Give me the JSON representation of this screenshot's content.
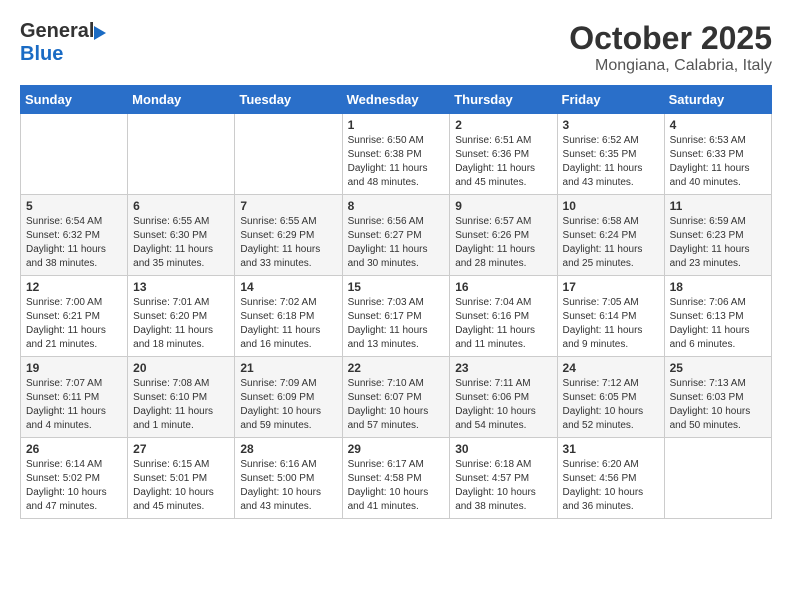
{
  "header": {
    "title": "October 2025",
    "subtitle": "Mongiana, Calabria, Italy",
    "logo_general": "General",
    "logo_blue": "Blue"
  },
  "days_of_week": [
    "Sunday",
    "Monday",
    "Tuesday",
    "Wednesday",
    "Thursday",
    "Friday",
    "Saturday"
  ],
  "weeks": [
    [
      {
        "day": "",
        "info": ""
      },
      {
        "day": "",
        "info": ""
      },
      {
        "day": "",
        "info": ""
      },
      {
        "day": "1",
        "info": "Sunrise: 6:50 AM\nSunset: 6:38 PM\nDaylight: 11 hours\nand 48 minutes."
      },
      {
        "day": "2",
        "info": "Sunrise: 6:51 AM\nSunset: 6:36 PM\nDaylight: 11 hours\nand 45 minutes."
      },
      {
        "day": "3",
        "info": "Sunrise: 6:52 AM\nSunset: 6:35 PM\nDaylight: 11 hours\nand 43 minutes."
      },
      {
        "day": "4",
        "info": "Sunrise: 6:53 AM\nSunset: 6:33 PM\nDaylight: 11 hours\nand 40 minutes."
      }
    ],
    [
      {
        "day": "5",
        "info": "Sunrise: 6:54 AM\nSunset: 6:32 PM\nDaylight: 11 hours\nand 38 minutes."
      },
      {
        "day": "6",
        "info": "Sunrise: 6:55 AM\nSunset: 6:30 PM\nDaylight: 11 hours\nand 35 minutes."
      },
      {
        "day": "7",
        "info": "Sunrise: 6:55 AM\nSunset: 6:29 PM\nDaylight: 11 hours\nand 33 minutes."
      },
      {
        "day": "8",
        "info": "Sunrise: 6:56 AM\nSunset: 6:27 PM\nDaylight: 11 hours\nand 30 minutes."
      },
      {
        "day": "9",
        "info": "Sunrise: 6:57 AM\nSunset: 6:26 PM\nDaylight: 11 hours\nand 28 minutes."
      },
      {
        "day": "10",
        "info": "Sunrise: 6:58 AM\nSunset: 6:24 PM\nDaylight: 11 hours\nand 25 minutes."
      },
      {
        "day": "11",
        "info": "Sunrise: 6:59 AM\nSunset: 6:23 PM\nDaylight: 11 hours\nand 23 minutes."
      }
    ],
    [
      {
        "day": "12",
        "info": "Sunrise: 7:00 AM\nSunset: 6:21 PM\nDaylight: 11 hours\nand 21 minutes."
      },
      {
        "day": "13",
        "info": "Sunrise: 7:01 AM\nSunset: 6:20 PM\nDaylight: 11 hours\nand 18 minutes."
      },
      {
        "day": "14",
        "info": "Sunrise: 7:02 AM\nSunset: 6:18 PM\nDaylight: 11 hours\nand 16 minutes."
      },
      {
        "day": "15",
        "info": "Sunrise: 7:03 AM\nSunset: 6:17 PM\nDaylight: 11 hours\nand 13 minutes."
      },
      {
        "day": "16",
        "info": "Sunrise: 7:04 AM\nSunset: 6:16 PM\nDaylight: 11 hours\nand 11 minutes."
      },
      {
        "day": "17",
        "info": "Sunrise: 7:05 AM\nSunset: 6:14 PM\nDaylight: 11 hours\nand 9 minutes."
      },
      {
        "day": "18",
        "info": "Sunrise: 7:06 AM\nSunset: 6:13 PM\nDaylight: 11 hours\nand 6 minutes."
      }
    ],
    [
      {
        "day": "19",
        "info": "Sunrise: 7:07 AM\nSunset: 6:11 PM\nDaylight: 11 hours\nand 4 minutes."
      },
      {
        "day": "20",
        "info": "Sunrise: 7:08 AM\nSunset: 6:10 PM\nDaylight: 11 hours\nand 1 minute."
      },
      {
        "day": "21",
        "info": "Sunrise: 7:09 AM\nSunset: 6:09 PM\nDaylight: 10 hours\nand 59 minutes."
      },
      {
        "day": "22",
        "info": "Sunrise: 7:10 AM\nSunset: 6:07 PM\nDaylight: 10 hours\nand 57 minutes."
      },
      {
        "day": "23",
        "info": "Sunrise: 7:11 AM\nSunset: 6:06 PM\nDaylight: 10 hours\nand 54 minutes."
      },
      {
        "day": "24",
        "info": "Sunrise: 7:12 AM\nSunset: 6:05 PM\nDaylight: 10 hours\nand 52 minutes."
      },
      {
        "day": "25",
        "info": "Sunrise: 7:13 AM\nSunset: 6:03 PM\nDaylight: 10 hours\nand 50 minutes."
      }
    ],
    [
      {
        "day": "26",
        "info": "Sunrise: 6:14 AM\nSunset: 5:02 PM\nDaylight: 10 hours\nand 47 minutes."
      },
      {
        "day": "27",
        "info": "Sunrise: 6:15 AM\nSunset: 5:01 PM\nDaylight: 10 hours\nand 45 minutes."
      },
      {
        "day": "28",
        "info": "Sunrise: 6:16 AM\nSunset: 5:00 PM\nDaylight: 10 hours\nand 43 minutes."
      },
      {
        "day": "29",
        "info": "Sunrise: 6:17 AM\nSunset: 4:58 PM\nDaylight: 10 hours\nand 41 minutes."
      },
      {
        "day": "30",
        "info": "Sunrise: 6:18 AM\nSunset: 4:57 PM\nDaylight: 10 hours\nand 38 minutes."
      },
      {
        "day": "31",
        "info": "Sunrise: 6:20 AM\nSunset: 4:56 PM\nDaylight: 10 hours\nand 36 minutes."
      },
      {
        "day": "",
        "info": ""
      }
    ]
  ]
}
